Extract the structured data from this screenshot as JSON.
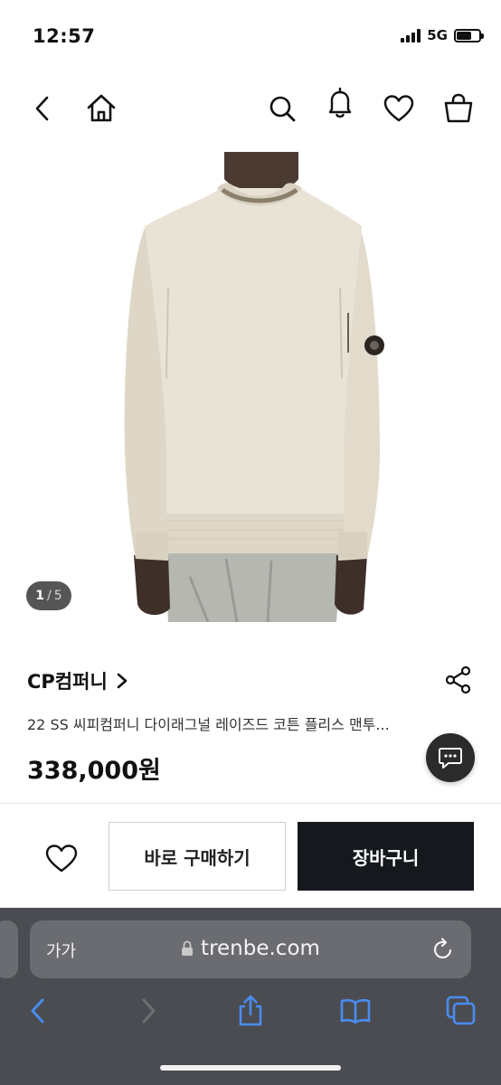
{
  "status": {
    "time": "12:57",
    "network": "5G"
  },
  "header": {
    "icons": [
      "back-icon",
      "home-icon",
      "search-icon",
      "bell-icon",
      "heart-icon",
      "bag-icon"
    ]
  },
  "gallery": {
    "current": "1",
    "separator": "/",
    "total": "5"
  },
  "product": {
    "brand": "CP컴퍼니",
    "title": "22 SS 씨피컴퍼니 다이래그널 레이즈드 코튼 플리스 맨투...",
    "price": "338,000원"
  },
  "actions": {
    "buy_now_label": "바로 구매하기",
    "cart_label": "장바구니"
  },
  "browser": {
    "aa_label": "가가",
    "url": "trenbe.com"
  },
  "colors": {
    "cart_button": "#15181c",
    "browser_bg": "#4a4c51",
    "browser_accent": "#4a8cf0",
    "sweater": "#e9e3d6"
  }
}
